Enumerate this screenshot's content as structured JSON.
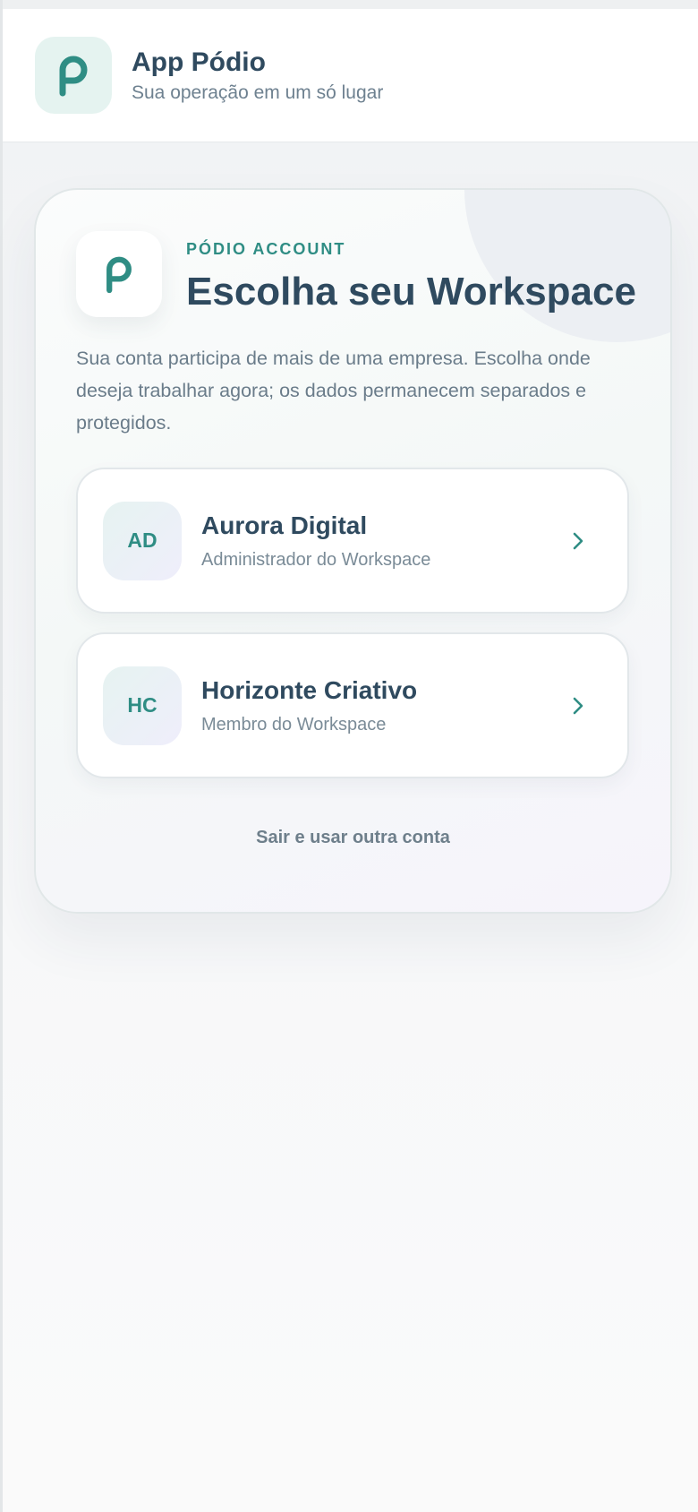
{
  "header": {
    "title": "App Pódio",
    "subtitle": "Sua operação em um só lugar",
    "logo_icon": "podio-p-logo-icon"
  },
  "card": {
    "eyebrow": "PÓDIO ACCOUNT",
    "title": "Escolha seu Workspace",
    "description": "Sua conta participa de mais de uma empresa. Escolha onde deseja trabalhar agora; os dados permanecem separados e protegidos.",
    "workspaces": [
      {
        "initials": "AD",
        "name": "Aurora Digital",
        "role": "Administrador do Workspace"
      },
      {
        "initials": "HC",
        "name": "Horizonte Criativo",
        "role": "Membro do Workspace"
      }
    ],
    "logout_label": "Sair e usar outra conta"
  },
  "colors": {
    "accent": "#2f8d84",
    "heading": "#2f4a5f",
    "muted": "#6e8190"
  }
}
